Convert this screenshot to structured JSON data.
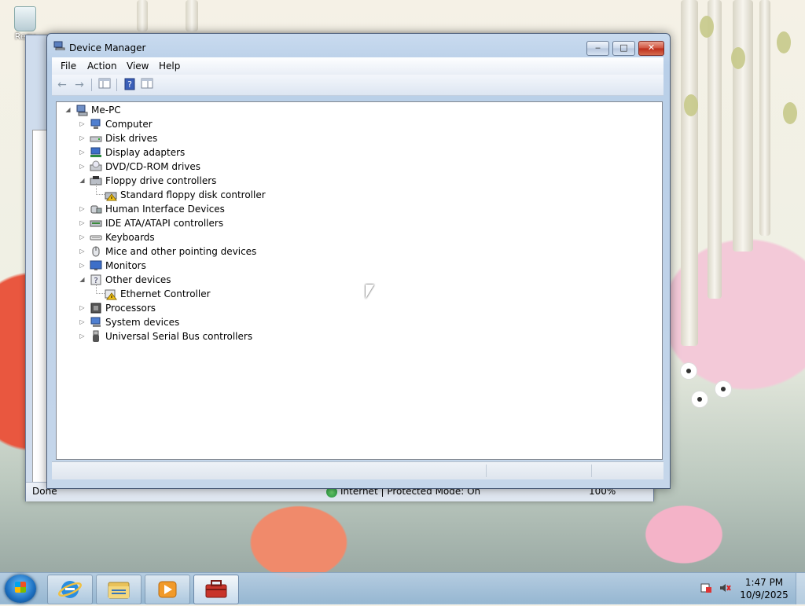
{
  "desktop": {
    "recycle_bin_label": "Recy"
  },
  "ie_window": {
    "status_left": "Done",
    "status_zone": "Internet | Protected Mode: On",
    "status_zoom": "100%"
  },
  "device_manager": {
    "title": "Device Manager",
    "menu": [
      "File",
      "Action",
      "View",
      "Help"
    ],
    "toolbar_icons": [
      "back-arrow-icon",
      "forward-arrow-icon",
      "show-hide-console-tree-icon",
      "help-icon",
      "properties-icon"
    ],
    "tree": {
      "root": "Me-PC",
      "categories": [
        {
          "label": "Computer",
          "icon": "computer-icon",
          "expanded": false
        },
        {
          "label": "Disk drives",
          "icon": "disk-drive-icon",
          "expanded": false
        },
        {
          "label": "Display adapters",
          "icon": "display-adapter-icon",
          "expanded": false
        },
        {
          "label": "DVD/CD-ROM drives",
          "icon": "dvd-drive-icon",
          "expanded": false
        },
        {
          "label": "Floppy drive controllers",
          "icon": "floppy-controller-icon",
          "expanded": true,
          "children": [
            {
              "label": "Standard floppy disk controller",
              "icon": "floppy-controller-warning-icon"
            }
          ]
        },
        {
          "label": "Human Interface Devices",
          "icon": "hid-icon",
          "expanded": false
        },
        {
          "label": "IDE ATA/ATAPI controllers",
          "icon": "ide-controller-icon",
          "expanded": false
        },
        {
          "label": "Keyboards",
          "icon": "keyboard-icon",
          "expanded": false
        },
        {
          "label": "Mice and other pointing devices",
          "icon": "mouse-icon",
          "expanded": false
        },
        {
          "label": "Monitors",
          "icon": "monitor-icon",
          "expanded": false
        },
        {
          "label": "Other devices",
          "icon": "unknown-device-icon",
          "expanded": true,
          "children": [
            {
              "label": "Ethernet Controller",
              "icon": "ethernet-warning-icon"
            }
          ]
        },
        {
          "label": "Processors",
          "icon": "processor-icon",
          "expanded": false
        },
        {
          "label": "System devices",
          "icon": "system-device-icon",
          "expanded": false
        },
        {
          "label": "Universal Serial Bus controllers",
          "icon": "usb-icon",
          "expanded": false
        }
      ]
    }
  },
  "taskbar": {
    "apps": [
      "internet-explorer-icon",
      "windows-explorer-icon",
      "media-player-icon",
      "device-manager-toolbox-icon"
    ],
    "active_app": "device-manager-toolbox-icon",
    "tray_icons": [
      "action-center-icon",
      "speaker-muted-icon"
    ],
    "time": "1:47 PM",
    "date": "10/9/2025"
  }
}
